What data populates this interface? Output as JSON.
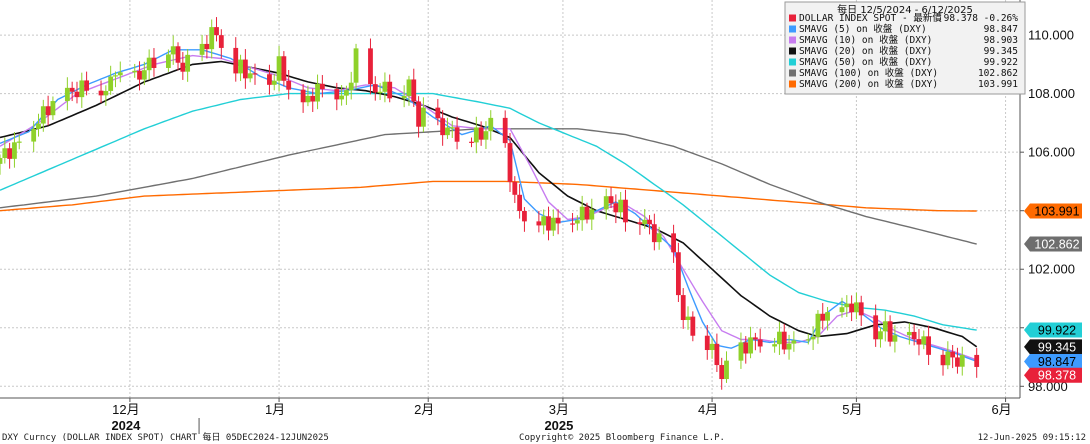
{
  "chart_data": {
    "type": "candlestick-line",
    "title": "每日 12/5/2024 - 6/12/2025",
    "ylim": [
      97.6,
      111.2
    ],
    "y_ticks": [
      "110.000",
      "108.000",
      "106.000",
      "104.000",
      "102.000",
      "100.000",
      "98.000"
    ],
    "y_tick_values": [
      110,
      108,
      106,
      104,
      102,
      100,
      98
    ],
    "months": [
      {
        "label": "12月",
        "day": 27
      },
      {
        "label": "1月",
        "day": 58
      },
      {
        "label": "2月",
        "day": 89
      },
      {
        "label": "3月",
        "day": 117
      },
      {
        "label": "4月",
        "day": 148
      },
      {
        "label": "5月",
        "day": 178
      },
      {
        "label": "6月",
        "day": 209
      }
    ],
    "years": [
      {
        "label": "2024",
        "day": 27
      },
      {
        "label": "2025",
        "day": 117
      }
    ],
    "legend": [
      {
        "name": "DOLLAR INDEX SPOT - 最新價",
        "value": "98.378",
        "change": "-0.26%",
        "color": "#e8213a"
      },
      {
        "name": "SMAVG (5)  on 收盤 (DXY)",
        "value": "98.847",
        "color": "#3d9bff"
      },
      {
        "name": "SMAVG (10)  on 收盤 (DXY)",
        "value": "98.903",
        "color": "#c77cf0"
      },
      {
        "name": "SMAVG (20)  on 收盤 (DXY)",
        "value": "99.345",
        "color": "#111111"
      },
      {
        "name": "SMAVG (50)  on 收盤 (DXY)",
        "value": "99.922",
        "color": "#22cfd6"
      },
      {
        "name": "SMAVG (100)  on 收盤 (DXY)",
        "value": "102.862",
        "color": "#707070"
      },
      {
        "name": "SMAVG (200)  on 收盤 (DXY)",
        "value": "103.991",
        "color": "#ff6a00"
      }
    ],
    "last_value_labels": [
      {
        "text": "103.991",
        "value": 103.991,
        "bg": "#ff6a00",
        "fg": "#000000"
      },
      {
        "text": "102.862",
        "value": 102.862,
        "bg": "#6e6e6e",
        "fg": "#ffffff"
      },
      {
        "text": "99.922",
        "value": 99.922,
        "bg": "#22cfd6",
        "fg": "#000000"
      },
      {
        "text": "99.345",
        "value": 99.345,
        "bg": "#111111",
        "fg": "#ffffff"
      },
      {
        "text": "98.847",
        "value": 98.847,
        "bg": "#3d9bff",
        "fg": "#000000"
      },
      {
        "text": "98.378",
        "value": 98.378,
        "bg": "#e8213a",
        "fg": "#ffffff"
      }
    ],
    "candle_colors": {
      "up": "#8fd12a",
      "down": "#e8213a"
    },
    "close_anchors": [
      [
        0,
        105.8
      ],
      [
        4,
        106.3
      ],
      [
        8,
        107.1
      ],
      [
        12,
        107.9
      ],
      [
        16,
        108.1
      ],
      [
        20,
        108.4
      ],
      [
        22,
        108.0
      ],
      [
        24,
        108.9
      ],
      [
        26,
        108.1
      ],
      [
        28,
        108.5
      ],
      [
        31,
        109.0
      ],
      [
        35,
        109.6
      ],
      [
        38,
        108.9
      ],
      [
        42,
        109.5
      ],
      [
        44,
        110.1
      ],
      [
        46,
        109.8
      ],
      [
        48,
        108.7
      ],
      [
        50,
        108.9
      ],
      [
        53,
        108.5
      ],
      [
        56,
        108.3
      ],
      [
        58,
        109.0
      ],
      [
        60,
        108.2
      ],
      [
        63,
        107.6
      ],
      [
        65,
        108.0
      ],
      [
        68,
        108.3
      ],
      [
        70,
        108.0
      ],
      [
        72,
        107.9
      ],
      [
        74,
        109.4
      ],
      [
        76,
        108.0
      ],
      [
        79,
        108.2
      ],
      [
        82,
        108.0
      ],
      [
        85,
        108.3
      ],
      [
        87,
        107.1
      ],
      [
        89,
        107.4
      ],
      [
        91,
        106.9
      ],
      [
        94,
        106.7
      ],
      [
        97,
        106.5
      ],
      [
        100,
        106.6
      ],
      [
        103,
        107.1
      ],
      [
        105,
        106.2
      ],
      [
        107,
        104.3
      ],
      [
        109,
        103.8
      ],
      [
        111,
        103.4
      ],
      [
        113,
        103.6
      ],
      [
        115,
        103.6
      ],
      [
        117,
        103.4
      ],
      [
        120,
        103.8
      ],
      [
        123,
        104.0
      ],
      [
        126,
        104.3
      ],
      [
        129,
        104.1
      ],
      [
        131,
        103.4
      ],
      [
        133,
        103.8
      ],
      [
        135,
        103.4
      ],
      [
        137,
        103.0
      ],
      [
        139,
        102.9
      ],
      [
        140,
        102.3
      ],
      [
        142,
        100.3
      ],
      [
        144,
        100.0
      ],
      [
        146,
        99.8
      ],
      [
        148,
        99.2
      ],
      [
        150,
        98.4
      ],
      [
        152,
        98.8
      ],
      [
        154,
        99.3
      ],
      [
        156,
        99.5
      ],
      [
        158,
        99.6
      ],
      [
        160,
        99.5
      ],
      [
        162,
        99.6
      ],
      [
        164,
        99.4
      ],
      [
        166,
        99.4
      ],
      [
        168,
        99.6
      ],
      [
        170,
        100.2
      ],
      [
        173,
        100.8
      ],
      [
        175,
        100.6
      ],
      [
        177,
        100.8
      ],
      [
        180,
        100.3
      ],
      [
        182,
        99.8
      ],
      [
        184,
        100.0
      ],
      [
        187,
        99.4
      ],
      [
        190,
        99.7
      ],
      [
        193,
        99.3
      ],
      [
        195,
        99.0
      ],
      [
        197,
        99.0
      ],
      [
        199,
        98.9
      ],
      [
        201,
        98.7
      ],
      [
        203,
        98.4
      ]
    ],
    "sma_anchors": {
      "sma5": [
        [
          0,
          106.3
        ],
        [
          6,
          106.7
        ],
        [
          12,
          107.8
        ],
        [
          18,
          108.3
        ],
        [
          24,
          108.7
        ],
        [
          30,
          109.0
        ],
        [
          36,
          109.5
        ],
        [
          42,
          109.5
        ],
        [
          48,
          109.2
        ],
        [
          54,
          108.6
        ],
        [
          60,
          108.2
        ],
        [
          66,
          108.0
        ],
        [
          72,
          108.1
        ],
        [
          78,
          108.3
        ],
        [
          84,
          107.9
        ],
        [
          90,
          107.2
        ],
        [
          96,
          106.6
        ],
        [
          102,
          106.9
        ],
        [
          106,
          106.4
        ],
        [
          109,
          104.4
        ],
        [
          112,
          103.9
        ],
        [
          116,
          103.6
        ],
        [
          120,
          103.7
        ],
        [
          124,
          104.0
        ],
        [
          128,
          104.3
        ],
        [
          132,
          103.9
        ],
        [
          136,
          103.3
        ],
        [
          140,
          102.7
        ],
        [
          143,
          101.4
        ],
        [
          146,
          100.2
        ],
        [
          149,
          99.4
        ],
        [
          152,
          99.3
        ],
        [
          156,
          99.6
        ],
        [
          160,
          99.5
        ],
        [
          164,
          99.6
        ],
        [
          168,
          99.5
        ],
        [
          171,
          100.4
        ],
        [
          175,
          100.9
        ],
        [
          179,
          100.5
        ],
        [
          183,
          100.0
        ],
        [
          187,
          99.7
        ],
        [
          191,
          99.5
        ],
        [
          195,
          99.3
        ],
        [
          199,
          99.1
        ],
        [
          203,
          98.85
        ]
      ],
      "sma10": [
        [
          0,
          106.2
        ],
        [
          8,
          107.0
        ],
        [
          16,
          108.0
        ],
        [
          24,
          108.5
        ],
        [
          32,
          109.0
        ],
        [
          40,
          109.3
        ],
        [
          46,
          109.2
        ],
        [
          52,
          108.9
        ],
        [
          58,
          108.6
        ],
        [
          64,
          108.2
        ],
        [
          70,
          108.1
        ],
        [
          76,
          108.3
        ],
        [
          82,
          108.2
        ],
        [
          88,
          107.6
        ],
        [
          94,
          106.9
        ],
        [
          100,
          106.8
        ],
        [
          106,
          106.8
        ],
        [
          110,
          105.6
        ],
        [
          114,
          104.3
        ],
        [
          118,
          103.7
        ],
        [
          122,
          103.8
        ],
        [
          126,
          104.1
        ],
        [
          130,
          104.2
        ],
        [
          134,
          103.8
        ],
        [
          138,
          103.1
        ],
        [
          142,
          102.0
        ],
        [
          146,
          100.9
        ],
        [
          150,
          99.9
        ],
        [
          154,
          99.6
        ],
        [
          158,
          99.6
        ],
        [
          162,
          99.5
        ],
        [
          166,
          99.5
        ],
        [
          170,
          99.7
        ],
        [
          174,
          100.4
        ],
        [
          178,
          100.6
        ],
        [
          182,
          100.3
        ],
        [
          186,
          99.9
        ],
        [
          190,
          99.6
        ],
        [
          194,
          99.4
        ],
        [
          198,
          99.2
        ],
        [
          203,
          98.9
        ]
      ],
      "sma20": [
        [
          0,
          106.5
        ],
        [
          10,
          106.9
        ],
        [
          20,
          107.6
        ],
        [
          30,
          108.4
        ],
        [
          40,
          109.0
        ],
        [
          46,
          109.1
        ],
        [
          52,
          108.9
        ],
        [
          58,
          108.7
        ],
        [
          64,
          108.4
        ],
        [
          70,
          108.2
        ],
        [
          76,
          108.1
        ],
        [
          82,
          107.9
        ],
        [
          88,
          107.6
        ],
        [
          94,
          107.2
        ],
        [
          100,
          106.9
        ],
        [
          106,
          106.5
        ],
        [
          112,
          105.3
        ],
        [
          118,
          104.5
        ],
        [
          124,
          104.0
        ],
        [
          130,
          103.7
        ],
        [
          136,
          103.4
        ],
        [
          142,
          102.9
        ],
        [
          148,
          102.0
        ],
        [
          154,
          101.1
        ],
        [
          160,
          100.4
        ],
        [
          166,
          99.9
        ],
        [
          170,
          99.7
        ],
        [
          176,
          99.8
        ],
        [
          182,
          100.1
        ],
        [
          188,
          100.2
        ],
        [
          194,
          100.0
        ],
        [
          200,
          99.7
        ],
        [
          203,
          99.35
        ]
      ],
      "sma50": [
        [
          0,
          104.7
        ],
        [
          10,
          105.4
        ],
        [
          20,
          106.1
        ],
        [
          30,
          106.8
        ],
        [
          40,
          107.4
        ],
        [
          50,
          107.8
        ],
        [
          60,
          108.0
        ],
        [
          70,
          108.0
        ],
        [
          80,
          108.0
        ],
        [
          90,
          108.0
        ],
        [
          100,
          107.7
        ],
        [
          106,
          107.5
        ],
        [
          112,
          107.0
        ],
        [
          118,
          106.6
        ],
        [
          124,
          106.2
        ],
        [
          130,
          105.6
        ],
        [
          136,
          104.9
        ],
        [
          142,
          104.2
        ],
        [
          148,
          103.4
        ],
        [
          154,
          102.6
        ],
        [
          160,
          101.8
        ],
        [
          166,
          101.2
        ],
        [
          172,
          100.9
        ],
        [
          178,
          100.7
        ],
        [
          184,
          100.6
        ],
        [
          190,
          100.4
        ],
        [
          196,
          100.1
        ],
        [
          203,
          99.92
        ]
      ],
      "sma100": [
        [
          0,
          104.1
        ],
        [
          20,
          104.5
        ],
        [
          40,
          105.1
        ],
        [
          60,
          105.9
        ],
        [
          80,
          106.6
        ],
        [
          100,
          106.8
        ],
        [
          120,
          106.8
        ],
        [
          130,
          106.6
        ],
        [
          140,
          106.2
        ],
        [
          150,
          105.6
        ],
        [
          160,
          104.9
        ],
        [
          170,
          104.3
        ],
        [
          180,
          103.8
        ],
        [
          190,
          103.4
        ],
        [
          203,
          102.86
        ]
      ],
      "sma200": [
        [
          0,
          104.0
        ],
        [
          15,
          104.2
        ],
        [
          30,
          104.5
        ],
        [
          45,
          104.6
        ],
        [
          60,
          104.7
        ],
        [
          75,
          104.8
        ],
        [
          90,
          105.0
        ],
        [
          105,
          105.0
        ],
        [
          120,
          104.9
        ],
        [
          135,
          104.7
        ],
        [
          150,
          104.5
        ],
        [
          165,
          104.3
        ],
        [
          180,
          104.1
        ],
        [
          195,
          104.0
        ],
        [
          203,
          103.99
        ]
      ]
    }
  },
  "footer": {
    "left": "DXY Curncy (DOLLAR INDEX SPOT) CHART  每日 05DEC2024-12JUN2025",
    "center": "Copyright© 2025 Bloomberg Finance L.P.",
    "right": "12-Jun-2025 09:15:12"
  }
}
